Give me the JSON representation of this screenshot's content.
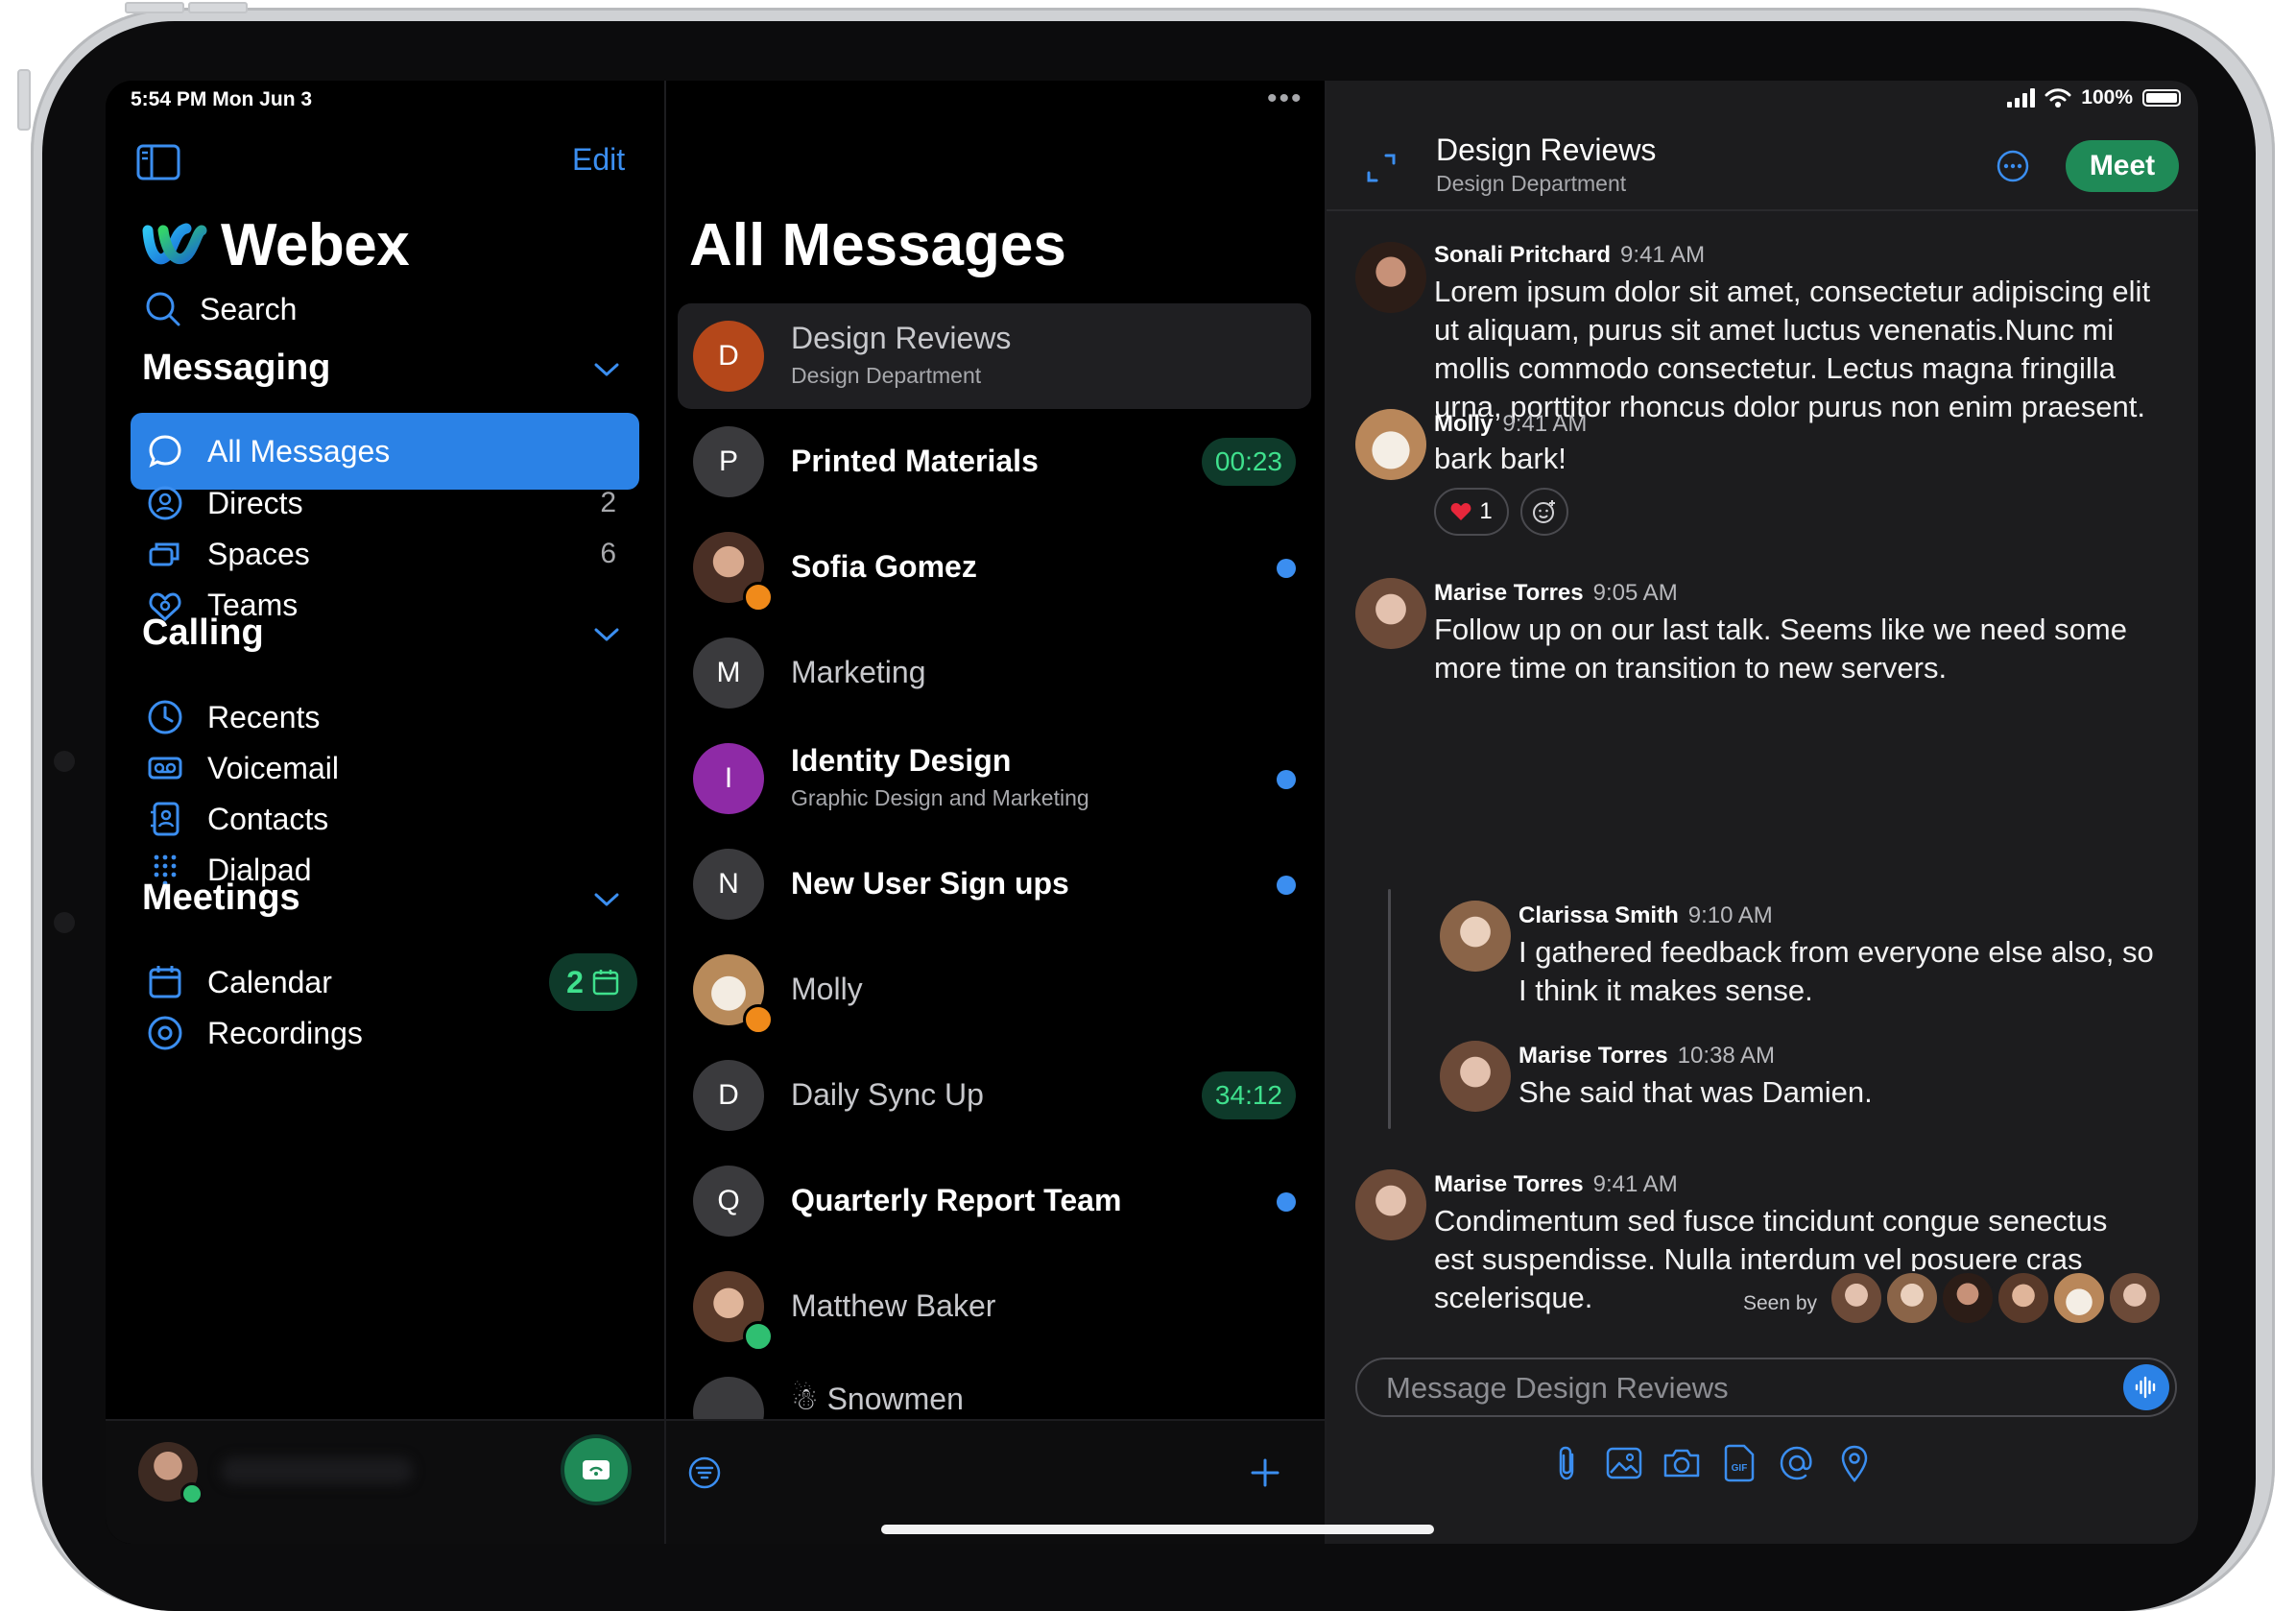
{
  "status": {
    "time": "5:54 PM  Mon Jun 3",
    "battery": "100%"
  },
  "sidebar": {
    "edit_label": "Edit",
    "brand": "Webex",
    "search_label": "Search",
    "messaging_title": "Messaging",
    "calling_title": "Calling",
    "meetings_title": "Meetings",
    "items": [
      {
        "label": "All Messages",
        "count": ""
      },
      {
        "label": "Directs",
        "count": "2"
      },
      {
        "label": "Spaces",
        "count": "6"
      },
      {
        "label": "Teams",
        "count": ""
      },
      {
        "label": "Recents",
        "count": ""
      },
      {
        "label": "Voicemail",
        "count": ""
      },
      {
        "label": "Contacts",
        "count": ""
      },
      {
        "label": "Dialpad",
        "count": ""
      },
      {
        "label": "Calendar",
        "count": "2"
      },
      {
        "label": "Recordings",
        "count": ""
      }
    ]
  },
  "list": {
    "title": "All Messages",
    "conversations": [
      {
        "initial": "D",
        "name": "Design Reviews",
        "sub": "Design Department",
        "badge": "",
        "color": "#b4471a"
      },
      {
        "initial": "P",
        "name": "Printed Materials",
        "sub": "",
        "badge": "00:23",
        "color": "#3a3a3d"
      },
      {
        "initial": "",
        "name": "Sofia Gomez",
        "sub": "",
        "badge": "",
        "color": "#6b4a3a"
      },
      {
        "initial": "M",
        "name": "Marketing",
        "sub": "",
        "badge": "",
        "color": "#3a3a3d"
      },
      {
        "initial": "I",
        "name": "Identity Design",
        "sub": "Graphic Design and Marketing",
        "badge": "",
        "color": "#8e2aa6"
      },
      {
        "initial": "N",
        "name": "New User Sign ups",
        "sub": "",
        "badge": "",
        "color": "#3a3a3d"
      },
      {
        "initial": "",
        "name": "Molly",
        "sub": "",
        "badge": "",
        "color": "#c9a47a"
      },
      {
        "initial": "D",
        "name": "Daily Sync Up",
        "sub": "",
        "badge": "34:12",
        "color": "#3a3a3d"
      },
      {
        "initial": "Q",
        "name": "Quarterly Report Team",
        "sub": "",
        "badge": "",
        "color": "#3a3a3d"
      },
      {
        "initial": "",
        "name": "Matthew Baker",
        "sub": "",
        "badge": "",
        "color": "#8a6a55"
      },
      {
        "initial": "",
        "name": "☃ Snowmen",
        "sub": "",
        "badge": "",
        "color": "#3a3a3d"
      }
    ]
  },
  "chat": {
    "title": "Design Reviews",
    "subtitle": "Design Department",
    "meet_label": "Meet",
    "messages": [
      {
        "author": "Sonali Pritchard",
        "time": "9:41 AM",
        "text": "Lorem ipsum dolor sit amet, consectetur adipiscing elit ut aliquam, purus sit amet luctus venenatis.Nunc mi mollis commodo consectetur. Lectus magna fringilla urna, porttitor rhoncus dolor purus non enim praesent."
      },
      {
        "author": "Molly",
        "time": "9:41 AM",
        "text": "bark bark!",
        "reaction_count": "1"
      },
      {
        "author": "Marise Torres",
        "time": "9:05 AM",
        "text": "Follow up on our last talk. Seems like we need some more time on transition to new servers."
      },
      {
        "author": "Clarissa Smith",
        "time": "9:10 AM",
        "text": "I gathered feedback from everyone else also, so I think it makes sense."
      },
      {
        "author": "Marise Torres",
        "time": "10:38 AM",
        "text": "She said that was Damien."
      },
      {
        "author": "Marise Torres",
        "time": "9:41 AM",
        "text": "Condimentum sed fusce tincidunt congue senectus est suspendisse. Nulla interdum vel posuere cras scelerisque."
      }
    ],
    "seen_by_label": "Seen by",
    "composer_placeholder": "Message Design Reviews"
  },
  "colors": {
    "accent": "#2b82e6",
    "meet": "#1f8a57",
    "timer_text": "#3fe08d"
  }
}
